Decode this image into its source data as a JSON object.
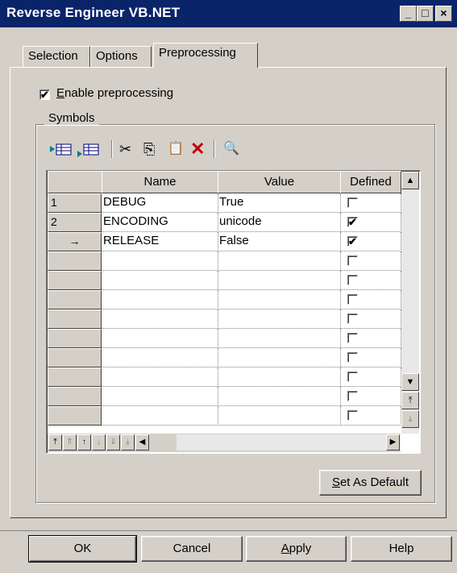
{
  "window": {
    "title": "Reverse Engineer VB.NET",
    "controls": [
      "_",
      "□",
      "×"
    ]
  },
  "tabs": [
    {
      "label": "Selection"
    },
    {
      "label": "Options"
    },
    {
      "label": "Preprocessing",
      "active": true
    }
  ],
  "enable_preprocessing": {
    "label": "nable preprocessing",
    "mnemonic": "E",
    "checked": true
  },
  "symbols": {
    "label": "Symbols",
    "toolbar": [
      {
        "icon": "insert-row-icon"
      },
      {
        "icon": "add-row-icon"
      },
      {
        "icon": "cut-icon",
        "glyph": "✂"
      },
      {
        "icon": "copy-icon",
        "glyph": "⎘"
      },
      {
        "icon": "paste-icon",
        "glyph": "📋"
      },
      {
        "icon": "delete-icon",
        "glyph": "✕"
      },
      {
        "icon": "find-icon",
        "glyph": "🔍"
      }
    ],
    "grid": {
      "columns": [
        "Name",
        "Value",
        "Defined"
      ],
      "rows": [
        {
          "num": "1",
          "name": "DEBUG",
          "value": "True",
          "defined": false
        },
        {
          "num": "2",
          "name": "ENCODING",
          "value": "unicode",
          "defined": true
        },
        {
          "num": "→",
          "name": "RELEASE",
          "value": "False",
          "defined": true
        }
      ],
      "empty_rows": 9
    }
  },
  "set_as_default": {
    "mnemonic": "S",
    "label": "et As Default"
  },
  "buttons": {
    "ok": "OK",
    "cancel": "Cancel",
    "apply_mnemonic": "A",
    "apply_rest": "pply",
    "help": "Help"
  },
  "colors": {
    "titlebar": "#0a246a",
    "face": "#d4d0c8"
  }
}
